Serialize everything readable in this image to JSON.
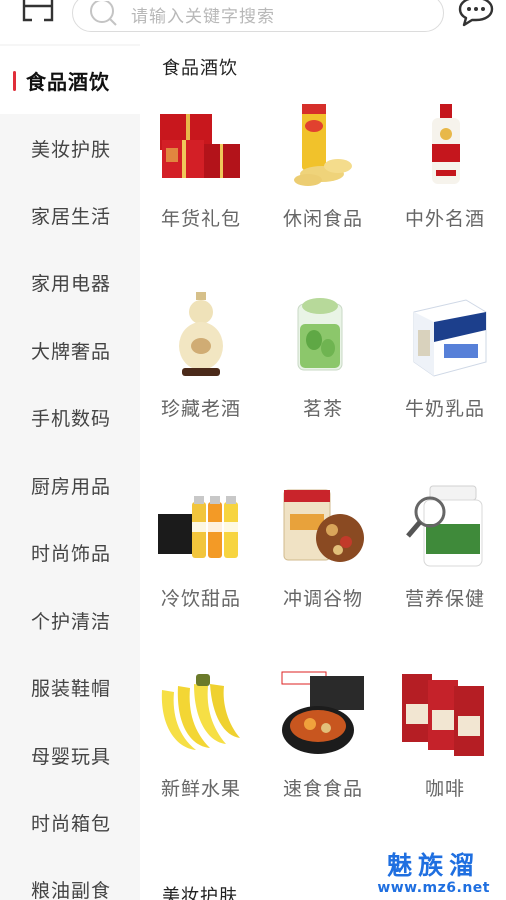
{
  "search": {
    "placeholder": "请输入关键字搜索"
  },
  "sidebar": {
    "items": [
      {
        "label": "食品酒饮",
        "active": true
      },
      {
        "label": "美妆护肤"
      },
      {
        "label": "家居生活"
      },
      {
        "label": "家用电器"
      },
      {
        "label": "大牌奢品"
      },
      {
        "label": "手机数码"
      },
      {
        "label": "厨房用品"
      },
      {
        "label": "时尚饰品"
      },
      {
        "label": "个护清洁"
      },
      {
        "label": "服装鞋帽"
      },
      {
        "label": "母婴玩具"
      },
      {
        "label": "时尚箱包"
      },
      {
        "label": "粮油副食"
      }
    ]
  },
  "content": {
    "section_title": "食品酒饮",
    "next_section_title": "美妆护肤",
    "items": [
      {
        "label": "年货礼包",
        "icon": "gift-box-icon"
      },
      {
        "label": "休闲食品",
        "icon": "chips-can-icon"
      },
      {
        "label": "中外名酒",
        "icon": "liquor-bottle-icon"
      },
      {
        "label": "珍藏老酒",
        "icon": "gourd-bottle-icon"
      },
      {
        "label": "茗茶",
        "icon": "tea-glass-icon"
      },
      {
        "label": "牛奶乳品",
        "icon": "milk-box-icon"
      },
      {
        "label": "冷饮甜品",
        "icon": "juice-bottles-icon"
      },
      {
        "label": "冲调谷物",
        "icon": "cereal-jar-icon"
      },
      {
        "label": "营养保健",
        "icon": "supplement-jar-icon"
      },
      {
        "label": "新鲜水果",
        "icon": "banana-icon"
      },
      {
        "label": "速食食品",
        "icon": "instant-hotpot-icon"
      },
      {
        "label": "咖啡",
        "icon": "coffee-box-icon"
      }
    ]
  },
  "watermark": {
    "text": "魅族溜",
    "url": "www.mz6.net"
  },
  "colors": {
    "accent": "#e02e3a",
    "sidebar_bg": "#f6f6f6",
    "watermark": "#1f6fe0"
  }
}
